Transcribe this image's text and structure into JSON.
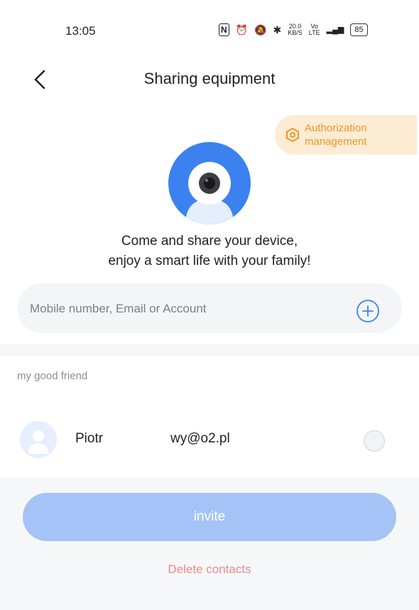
{
  "status_bar": {
    "time": "13:05",
    "nfc": "N",
    "alarm": "⏰",
    "mute": "🔕",
    "bluetooth": "✱",
    "speed_top": "20.0",
    "speed_bottom": "KB/S",
    "volte_top": "Vo",
    "volte_bottom": "LTE",
    "signal": "▂▄▆",
    "battery": "85"
  },
  "header": {
    "title": "Sharing equipment"
  },
  "authorization": {
    "line1": "Authorization",
    "line2": "management",
    "color": "#ee9628"
  },
  "intro": {
    "line1": "Come and share your device,",
    "line2": "enjoy a smart life with your family!"
  },
  "search": {
    "placeholder": "Mobile number, Email or Account",
    "value": ""
  },
  "friends": {
    "section_label": "my good friend",
    "contacts": [
      {
        "name": "Piotr",
        "email": "wy@o2.pl",
        "selected": false
      }
    ]
  },
  "actions": {
    "invite_label": "invite",
    "delete_label": "Delete contacts"
  },
  "colors": {
    "accent_blue": "#3b82f0",
    "invite_disabled": "#a5c3f6",
    "delete_red": "#ec8a8a",
    "auth_bg": "#fdecd4"
  }
}
